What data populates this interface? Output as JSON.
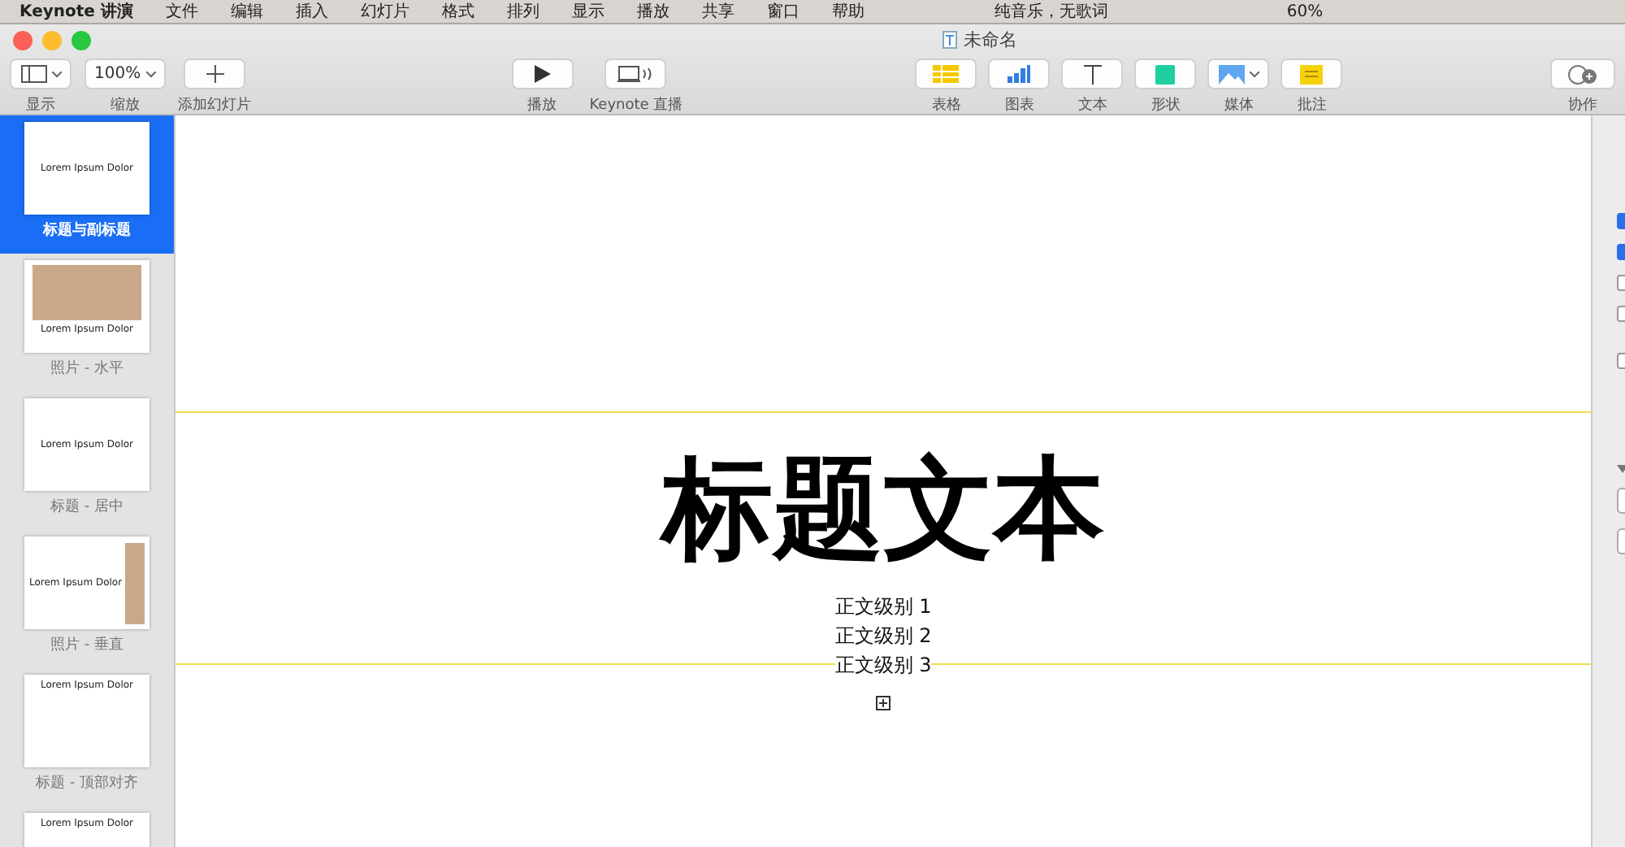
{
  "menu_bar": {
    "items": [
      "Keynote 讲演",
      "文件",
      "编辑",
      "插入",
      "幻灯片",
      "格式",
      "排列",
      "显示",
      "播放",
      "共享",
      "窗口",
      "帮助"
    ],
    "now_playing": "纯音乐，无歌词",
    "battery": "60%"
  },
  "window": {
    "title": "未命名"
  },
  "toolbar": {
    "left": [
      {
        "kind": "view",
        "label": "显示"
      },
      {
        "kind": "zoom",
        "label": "缩放",
        "value": "100%"
      },
      {
        "kind": "add",
        "label": "添加幻灯片"
      }
    ],
    "center": [
      {
        "kind": "play",
        "label": "播放"
      },
      {
        "kind": "live",
        "label": "Keynote 直播"
      }
    ],
    "insert": [
      {
        "kind": "table",
        "label": "表格"
      },
      {
        "kind": "chart",
        "label": "图表"
      },
      {
        "kind": "text",
        "label": "文本"
      },
      {
        "kind": "shape",
        "label": "形状"
      },
      {
        "kind": "media",
        "label": "媒体"
      },
      {
        "kind": "comment",
        "label": "批注"
      }
    ],
    "right": [
      {
        "kind": "collab",
        "label": "协作"
      }
    ]
  },
  "slides": [
    {
      "kind": "title",
      "label": "标题与副标题",
      "heading": "Lorem Ipsum Dolor",
      "selected": true
    },
    {
      "kind": "photo_h",
      "label": "照片 - 水平",
      "heading": "Lorem Ipsum Dolor",
      "selected": false
    },
    {
      "kind": "center",
      "label": "标题 - 居中",
      "heading": "Lorem Ipsum Dolor",
      "selected": false
    },
    {
      "kind": "photo_v",
      "label": "照片 - 垂直",
      "heading": "Lorem Ipsum Dolor",
      "selected": false
    },
    {
      "kind": "top",
      "label": "标题 - 顶部对齐",
      "heading": "Lorem Ipsum Dolor",
      "selected": false
    },
    {
      "kind": "top",
      "heading": "Lorem Ipsum Dolor",
      "selected": false
    }
  ],
  "slide": {
    "title": "标题文本",
    "body": [
      "正文级别 1",
      "正文级别 2",
      "正文级别 3"
    ]
  },
  "inspector": {
    "checkboxes": [
      {
        "checked": true
      },
      {
        "checked": true
      },
      {
        "checked": false
      },
      {
        "checked": false
      },
      {
        "checked": false
      }
    ]
  }
}
